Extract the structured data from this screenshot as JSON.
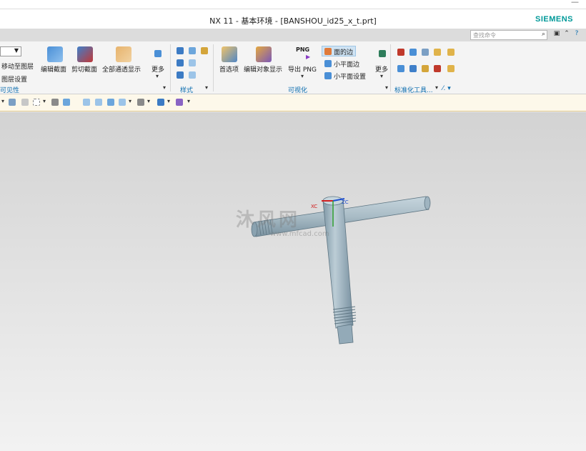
{
  "window": {
    "title": "NX 11 - 基本环境 - [BANSHOU_id25_x_t.prt]",
    "brand": "SIEMENS",
    "minimize_glyph": "—"
  },
  "command_bar": {
    "search_placeholder": "查找命令",
    "icons": [
      "search-icon",
      "window-icon",
      "collapse-ribbon-icon",
      "help-icon"
    ]
  },
  "ribbon": {
    "layer_group": {
      "move_to_layer": "移动至图层",
      "layer_settings": "图层设置",
      "label": "可见性"
    },
    "section_buttons": [
      {
        "label": "编辑截面",
        "icon": "edit-section-icon"
      },
      {
        "label": "剪切截面",
        "icon": "clip-section-icon"
      },
      {
        "label": "全部通透显示",
        "icon": "translucency-icon"
      },
      {
        "label": "更多",
        "icon": "more-icon"
      }
    ],
    "style_group": {
      "label": "样式"
    },
    "visualize_buttons": [
      {
        "label": "首选项",
        "icon": "preferences-icon"
      },
      {
        "label": "编辑对象显示",
        "icon": "edit-object-display-icon"
      },
      {
        "label": "导出 PNG",
        "icon": "export-png-icon",
        "badge": "PNG"
      }
    ],
    "edge_options": [
      {
        "label": "面的边",
        "active": true
      },
      {
        "label": "小平面边",
        "active": false
      },
      {
        "label": "小平面设置",
        "active": false
      }
    ],
    "visualize_more": "更多",
    "visualize_label": "可视化",
    "standardization_label": "标准化工具...",
    "trailing_label": "⁄. ▾"
  },
  "viewport": {
    "background_top": "#d3d3d3",
    "background_bottom": "#f2f2f2",
    "part_color": "#a9bcc6",
    "axis_x_label": "XC",
    "axis_z_label": "ZC",
    "watermark": "沐风网",
    "watermark_url": "www.mfcad.com"
  },
  "colors": {
    "accent_blue": "#0a6cae",
    "siemens_teal": "#009999",
    "toolbar_bg": "#fdf8ea"
  }
}
